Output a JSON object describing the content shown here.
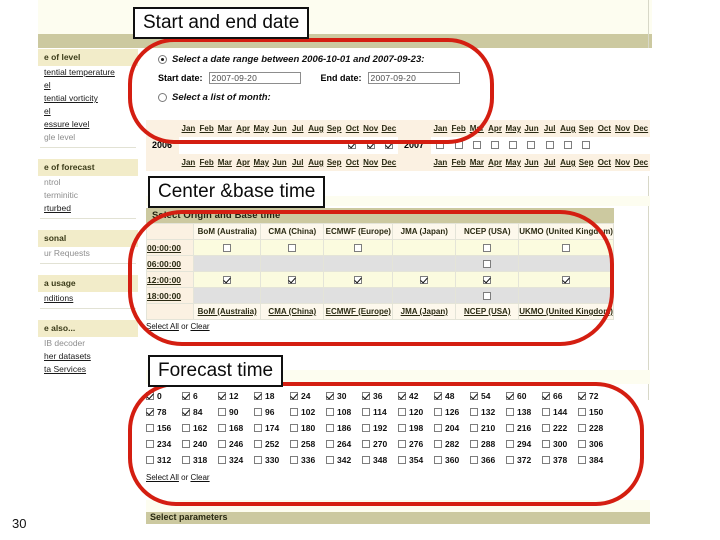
{
  "slide": {
    "page_number": "30"
  },
  "callouts": [
    {
      "id": "start-end-date",
      "text": "Start and end date"
    },
    {
      "id": "center-base-time",
      "text": "Center &base time"
    },
    {
      "id": "forecast-time",
      "text": "Forecast time"
    }
  ],
  "sidebar": {
    "groups": [
      {
        "heading": "e of level",
        "items": [
          {
            "label": "tential temperature",
            "style": "link"
          },
          {
            "label": "el",
            "style": "link"
          },
          {
            "label": "tential vorticity",
            "style": "link"
          },
          {
            "label": "el",
            "style": "link"
          },
          {
            "label": "essure level",
            "style": "link"
          },
          {
            "label": "gle level",
            "style": "plain"
          }
        ]
      },
      {
        "heading": "e of forecast",
        "items": [
          {
            "label": "ntrol",
            "style": "plain"
          },
          {
            "label": "terminitic",
            "style": "plain"
          },
          {
            "label": "rturbed",
            "style": "link"
          }
        ]
      },
      {
        "heading": "sonal",
        "items": [
          {
            "label": "ur Requests",
            "style": "plain"
          }
        ]
      },
      {
        "heading": "a usage",
        "items": [
          {
            "label": "nditions",
            "style": "link"
          }
        ]
      },
      {
        "heading": "e also...",
        "items": [
          {
            "label": "IB decoder",
            "style": "plain"
          },
          {
            "label": "her datasets",
            "style": "link"
          },
          {
            "label": "ta Services",
            "style": "link"
          }
        ]
      }
    ]
  },
  "date_range": {
    "radio_range_label": "Select a date range between 2006-10-01 and 2007-09-23:",
    "radio_range_selected": true,
    "start_date_label": "Start date:",
    "start_date_value": "2007-09-20",
    "end_date_label": "End date:",
    "end_date_value": "2007-09-20",
    "radio_month_label": "Select a list of month:",
    "radio_month_selected": false
  },
  "month_list": {
    "months": [
      "Jan",
      "Feb",
      "Mar",
      "Apr",
      "May",
      "Jun",
      "Jul",
      "Aug",
      "Sep",
      "Oct",
      "Nov",
      "Dec"
    ],
    "rows": [
      {
        "year": "2006",
        "checked_months": [
          "Oct",
          "Nov",
          "Dec"
        ],
        "available_months": [
          "Oct",
          "Nov",
          "Dec"
        ]
      },
      {
        "year": "2007",
        "checked_months": [],
        "available_months": [
          "Jan",
          "Feb",
          "Mar",
          "Apr",
          "May",
          "Jun",
          "Jul",
          "Aug",
          "Sep"
        ]
      }
    ]
  },
  "origin_base_time": {
    "section_title": "Select Origin and Base time",
    "centers": [
      "BoM (Australia)",
      "CMA (China)",
      "ECMWF (Europe)",
      "JMA (Japan)",
      "NCEP (USA)",
      "UKMO (United Kingdom)"
    ],
    "times": [
      "00:00:00",
      "06:00:00",
      "12:00:00",
      "18:00:00"
    ],
    "cells": [
      {
        "time": "00:00:00",
        "shade": "yellow",
        "available": [
          true,
          true,
          true,
          false,
          true,
          true
        ],
        "checked": [
          false,
          false,
          false,
          false,
          false,
          false
        ]
      },
      {
        "time": "06:00:00",
        "shade": "gray",
        "available": [
          false,
          false,
          false,
          false,
          true,
          false
        ],
        "checked": [
          false,
          false,
          false,
          false,
          false,
          false
        ]
      },
      {
        "time": "12:00:00",
        "shade": "yellow",
        "available": [
          true,
          true,
          true,
          true,
          true,
          true
        ],
        "checked": [
          true,
          true,
          true,
          true,
          true,
          true
        ]
      },
      {
        "time": "18:00:00",
        "shade": "gray",
        "available": [
          false,
          false,
          false,
          false,
          true,
          false
        ],
        "checked": [
          false,
          false,
          false,
          false,
          false,
          false
        ]
      }
    ],
    "select_all_label": "Select All",
    "or_label": " or ",
    "clear_label": "Clear"
  },
  "forecast_time": {
    "rows": [
      {
        "values": [
          0,
          6,
          12,
          18,
          24,
          30,
          36,
          42,
          48,
          54,
          60,
          66,
          72
        ],
        "checked": [
          true,
          true,
          true,
          true,
          true,
          true,
          true,
          true,
          true,
          true,
          true,
          true,
          true
        ]
      },
      {
        "values": [
          78,
          84,
          90,
          96,
          102,
          108,
          114,
          120,
          126,
          132,
          138,
          144,
          150
        ],
        "checked": [
          true,
          true,
          false,
          false,
          false,
          false,
          false,
          false,
          false,
          false,
          false,
          false,
          false
        ]
      },
      {
        "values": [
          156,
          162,
          168,
          174,
          180,
          186,
          192,
          198,
          204,
          210,
          216,
          222,
          228
        ],
        "checked": [
          false,
          false,
          false,
          false,
          false,
          false,
          false,
          false,
          false,
          false,
          false,
          false,
          false
        ]
      },
      {
        "values": [
          234,
          240,
          246,
          252,
          258,
          264,
          270,
          276,
          282,
          288,
          294,
          300,
          306
        ],
        "checked": [
          false,
          false,
          false,
          false,
          false,
          false,
          false,
          false,
          false,
          false,
          false,
          false,
          false
        ]
      },
      {
        "values": [
          312,
          318,
          324,
          330,
          336,
          342,
          348,
          354,
          360,
          366,
          372,
          378,
          384
        ],
        "checked": [
          false,
          false,
          false,
          false,
          false,
          false,
          false,
          false,
          false,
          false,
          false,
          false,
          false
        ]
      }
    ],
    "select_all_label": "Select All",
    "or_label": " or ",
    "clear_label": "Clear"
  },
  "next_section": {
    "title": "Select parameters"
  },
  "colors": {
    "annotation_red": "#d41e11",
    "header_khaki": "#ccc9a0",
    "sidebar_head": "#f2ecc9",
    "row_yellow": "#fbfbdf",
    "row_gray": "#e0e0e0",
    "time_cell": "#fbf1e2"
  }
}
